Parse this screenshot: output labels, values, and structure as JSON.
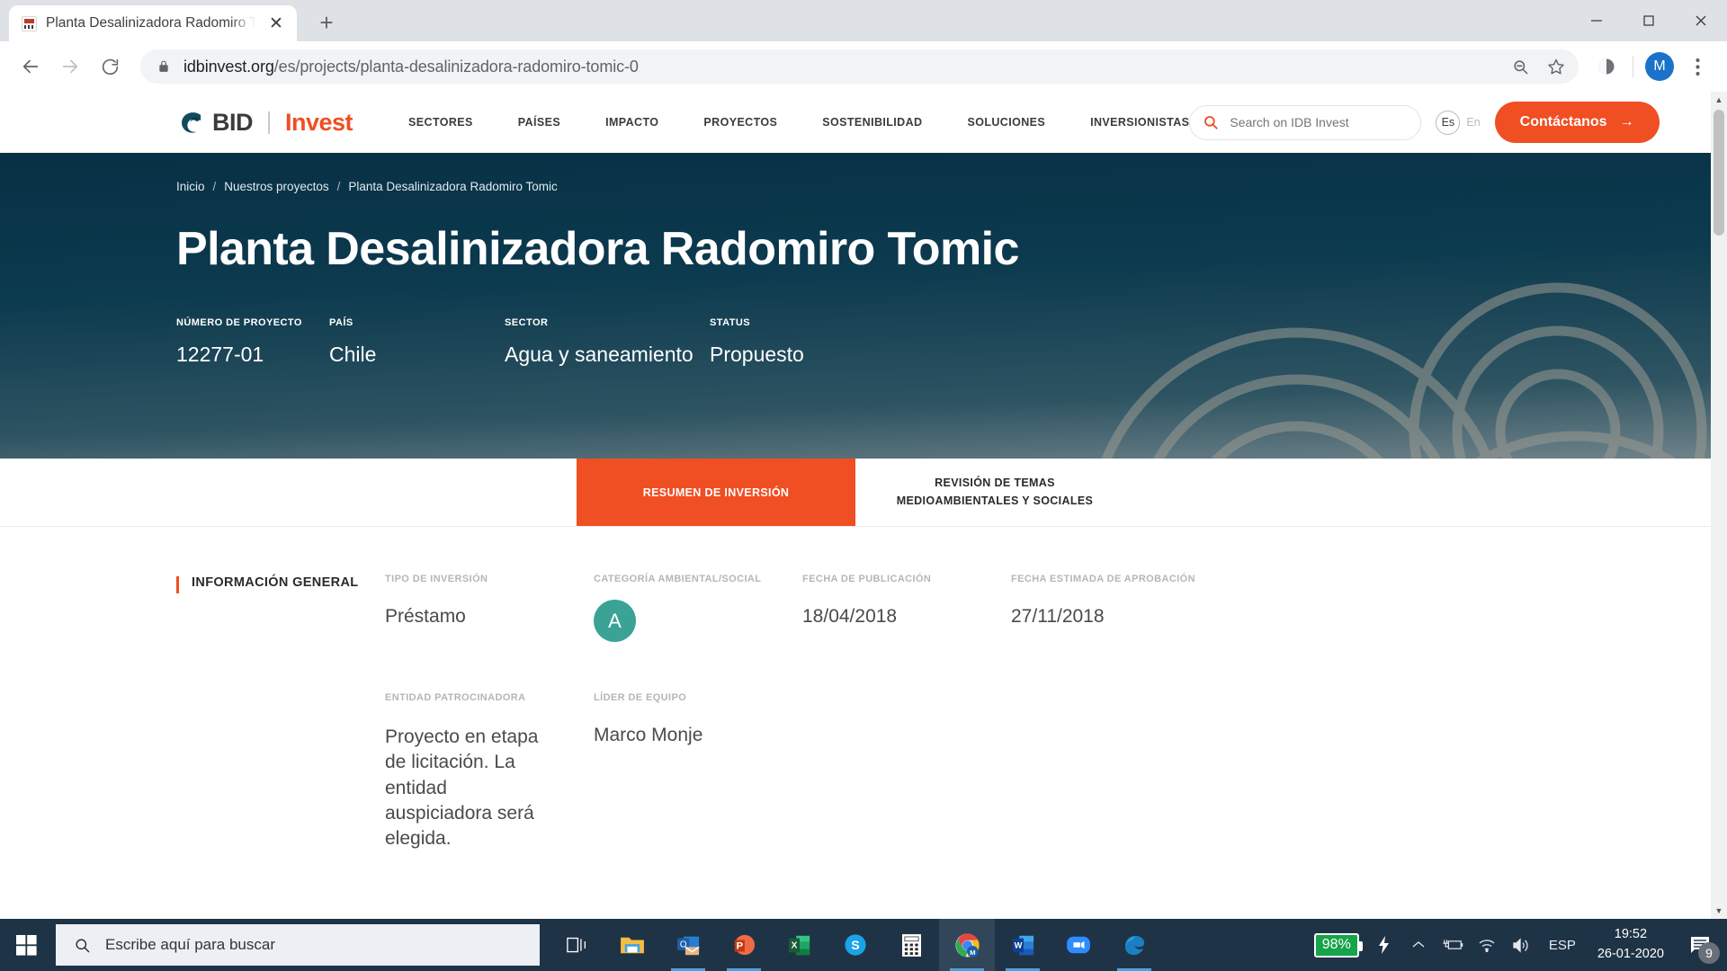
{
  "browser": {
    "tab": {
      "title": "Planta Desalinizadora Radomiro Tomic",
      "favicon": "site-favicon",
      "close": "✕"
    },
    "new_tab_label": "+",
    "window_controls": {
      "minimize": "minimize-icon",
      "maximize": "maximize-icon",
      "close": "close-icon"
    },
    "nav": {
      "back": "back-arrow-icon",
      "forward": "forward-arrow-icon",
      "reload": "reload-icon"
    },
    "omnibox": {
      "lock": "lock-icon",
      "url_domain": "idbinvest.org",
      "url_path": "/es/projects/planta-desalinizadora-radomiro-tomic-0",
      "zoom_out_icon": "zoom-out-icon",
      "bookmark_icon": "star-icon"
    },
    "profile_pill_icon": "profile-circle-icon",
    "avatar_letter": "M",
    "menu_icon": "three-dot-menu-icon"
  },
  "site": {
    "logo": {
      "mark": "globe-icon",
      "bid": "BID",
      "invest": "Invest"
    },
    "nav": [
      {
        "label": "SECTORES"
      },
      {
        "label": "PAÍSES"
      },
      {
        "label": "IMPACTO"
      },
      {
        "label": "PROYECTOS"
      },
      {
        "label": "SOSTENIBILIDAD"
      },
      {
        "label": "SOLUCIONES"
      },
      {
        "label": "INVERSIONISTAS"
      }
    ],
    "search": {
      "placeholder": "Search on IDB Invest",
      "value": "",
      "icon": "search-icon"
    },
    "language": {
      "active": "Es",
      "inactive": "En"
    },
    "contact_button": {
      "label": "Contáctanos",
      "arrow": "→"
    },
    "accent_color": "#f04e23"
  },
  "hero": {
    "breadcrumb": [
      {
        "label": "Inicio"
      },
      {
        "label": "Nuestros proyectos"
      },
      {
        "label": "Planta Desalinizadora Radomiro Tomic"
      }
    ],
    "breadcrumb_separator": "/",
    "title": "Planta Desalinizadora Radomiro Tomic",
    "meta": [
      {
        "label": "NÚMERO DE PROYECTO",
        "value": "12277-01"
      },
      {
        "label": "PAÍS",
        "value": "Chile"
      },
      {
        "label": "SECTOR",
        "value": "Agua y saneamiento"
      },
      {
        "label": "STATUS",
        "value": "Propuesto"
      }
    ],
    "background_color": "#0a3346",
    "decoration": "concentric-arcs"
  },
  "project_tabs": [
    {
      "label": "RESUMEN DE INVERSIÓN",
      "active": true
    },
    {
      "label": "REVISIÓN DE TEMAS MEDIOAMBIENTALES Y SOCIALES",
      "active": false
    }
  ],
  "main": {
    "section_title": "INFORMACIÓN GENERAL",
    "row1": [
      {
        "label": "TIPO DE INVERSIÓN",
        "value": "Préstamo"
      },
      {
        "label": "CATEGORÍA AMBIENTAL/SOCIAL",
        "value": "A",
        "badge_color": "#3aa396"
      },
      {
        "label": "FECHA DE PUBLICACIÓN",
        "value": "18/04/2018"
      },
      {
        "label": "FECHA ESTIMADA DE APROBACIÓN",
        "value": "27/11/2018"
      }
    ],
    "row2": [
      {
        "label": "ENTIDAD PATROCINADORA",
        "value": "Proyecto en etapa de licitación. La entidad auspiciadora será elegida."
      },
      {
        "label": "LÍDER DE EQUIPO",
        "value": "Marco Monje"
      }
    ]
  },
  "taskbar": {
    "start_icon": "windows-start-icon",
    "search": {
      "placeholder": "Escribe aquí para buscar",
      "icon": "search-icon"
    },
    "apps": [
      {
        "name": "task-view-icon"
      },
      {
        "name": "file-explorer-icon"
      },
      {
        "name": "outlook-icon"
      },
      {
        "name": "powerpoint-icon"
      },
      {
        "name": "excel-icon"
      },
      {
        "name": "skype-icon"
      },
      {
        "name": "calculator-icon"
      },
      {
        "name": "chrome-icon"
      },
      {
        "name": "word-icon"
      },
      {
        "name": "zoom-icon"
      },
      {
        "name": "edge-icon"
      }
    ],
    "battery": {
      "percent": "98%",
      "charging": true,
      "color": "#16a34a"
    },
    "tray_icons": [
      "chevron-up-icon",
      "plug-battery-icon",
      "wifi-icon",
      "volume-icon"
    ],
    "language": "ESP",
    "clock": {
      "time": "19:52",
      "date": "26-01-2020"
    },
    "notifications": {
      "icon": "notification-icon",
      "count": "9"
    }
  }
}
